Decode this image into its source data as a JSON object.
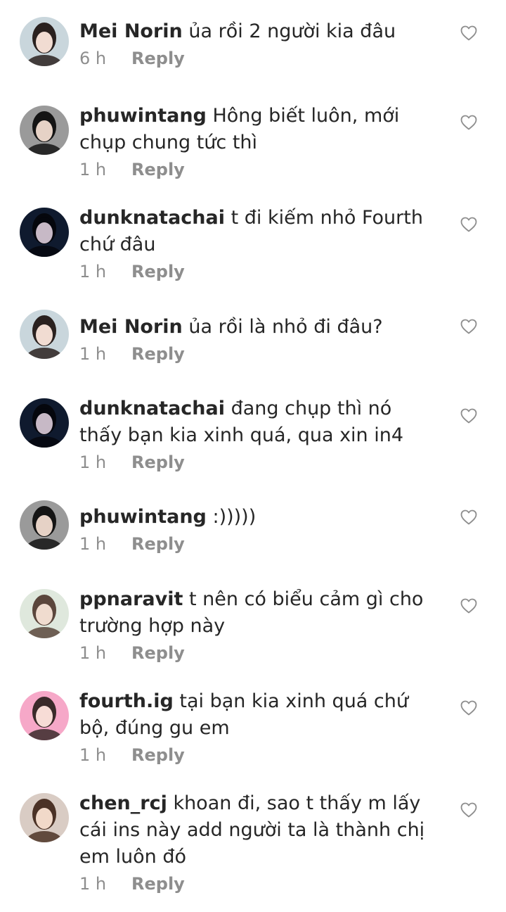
{
  "comments": [
    {
      "username": "Mei Norin",
      "text": "ủa rồi 2 người kia đâu",
      "time": "6 h",
      "reply": "Reply",
      "avatar_colors": [
        "#c9d6dc",
        "#2a211f",
        "#f1dcd2"
      ],
      "heart": "heart-outline-icon"
    },
    {
      "username": "phuwintang",
      "text": "Hông biết luôn, mới chụp chung tức thì",
      "time": "1 h",
      "reply": "Reply",
      "avatar_colors": [
        "#9a9a9a",
        "#141414",
        "#e6d2c6"
      ],
      "heart": "heart-outline-icon"
    },
    {
      "username": "dunknatachai",
      "text": "t đi kiếm nhỏ Fourth chứ đâu",
      "time": "1 h",
      "reply": "Reply",
      "avatar_colors": [
        "#0f1a2e",
        "#05070d",
        "#c7b9c6"
      ],
      "heart": "heart-outline-icon"
    },
    {
      "username": "Mei Norin",
      "text": "ủa rồi là nhỏ đi đâu?",
      "time": "1 h",
      "reply": "Reply",
      "avatar_colors": [
        "#c9d6dc",
        "#2a211f",
        "#f1dcd2"
      ],
      "heart": "heart-outline-icon"
    },
    {
      "username": "dunknatachai",
      "text": "đang chụp thì nó thấy bạn kia xinh quá, qua xin in4",
      "time": "1 h",
      "reply": "Reply",
      "avatar_colors": [
        "#0f1a2e",
        "#05070d",
        "#c7b9c6"
      ],
      "heart": "heart-outline-icon"
    },
    {
      "username": "phuwintang",
      "text": ":)))))",
      "time": "1 h",
      "reply": "Reply",
      "avatar_colors": [
        "#9a9a9a",
        "#141414",
        "#e6d2c6"
      ],
      "heart": "heart-outline-icon"
    },
    {
      "username": "ppnaravit",
      "text": "t nên có biểu cảm gì cho trường hợp này",
      "time": "1 h",
      "reply": "Reply",
      "avatar_colors": [
        "#dfe8dd",
        "#5b463c",
        "#f0dccf"
      ],
      "heart": "heart-outline-icon"
    },
    {
      "username": "fourth.ig",
      "text": "tại bạn kia xinh quá chứ bộ, đúng gu em",
      "time": "1 h",
      "reply": "Reply",
      "avatar_colors": [
        "#f6a8c8",
        "#3a2a2a",
        "#f7dcd6"
      ],
      "heart": "heart-outline-icon"
    },
    {
      "username": "chen_rcj",
      "text": "khoan đi, sao t thấy m lấy cái ins này add người ta là thành chị em luôn đó",
      "time": "1 h",
      "reply": "Reply",
      "avatar_colors": [
        "#d9ccc4",
        "#4b3226",
        "#f1d9c9"
      ],
      "heart": "heart-outline-icon"
    }
  ]
}
